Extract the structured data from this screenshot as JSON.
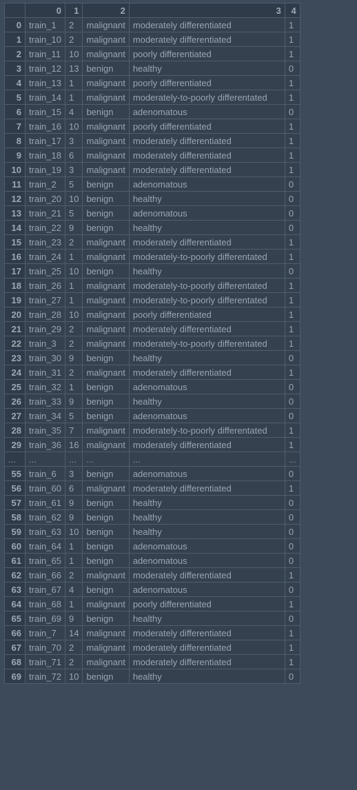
{
  "columns": [
    "0",
    "1",
    "2",
    "3",
    "4"
  ],
  "ellipsis": "...",
  "rows_top": [
    {
      "idx": "0",
      "c0": "train_1",
      "c1": "2",
      "c2": "malignant",
      "c3": "moderately differentiated",
      "c4": "1"
    },
    {
      "idx": "1",
      "c0": "train_10",
      "c1": "2",
      "c2": "malignant",
      "c3": "moderately differentiated",
      "c4": "1"
    },
    {
      "idx": "2",
      "c0": "train_11",
      "c1": "10",
      "c2": "malignant",
      "c3": "poorly differentiated",
      "c4": "1"
    },
    {
      "idx": "3",
      "c0": "train_12",
      "c1": "13",
      "c2": "benign",
      "c3": "healthy",
      "c4": "0"
    },
    {
      "idx": "4",
      "c0": "train_13",
      "c1": "1",
      "c2": "malignant",
      "c3": "poorly differentiated",
      "c4": "1"
    },
    {
      "idx": "5",
      "c0": "train_14",
      "c1": "1",
      "c2": "malignant",
      "c3": "moderately-to-poorly differentated",
      "c4": "1"
    },
    {
      "idx": "6",
      "c0": "train_15",
      "c1": "4",
      "c2": "benign",
      "c3": "adenomatous",
      "c4": "0"
    },
    {
      "idx": "7",
      "c0": "train_16",
      "c1": "10",
      "c2": "malignant",
      "c3": "poorly differentiated",
      "c4": "1"
    },
    {
      "idx": "8",
      "c0": "train_17",
      "c1": "3",
      "c2": "malignant",
      "c3": "moderately differentiated",
      "c4": "1"
    },
    {
      "idx": "9",
      "c0": "train_18",
      "c1": "6",
      "c2": "malignant",
      "c3": "moderately differentiated",
      "c4": "1"
    },
    {
      "idx": "10",
      "c0": "train_19",
      "c1": "3",
      "c2": "malignant",
      "c3": "moderately differentiated",
      "c4": "1"
    },
    {
      "idx": "11",
      "c0": "train_2",
      "c1": "5",
      "c2": "benign",
      "c3": "adenomatous",
      "c4": "0"
    },
    {
      "idx": "12",
      "c0": "train_20",
      "c1": "10",
      "c2": "benign",
      "c3": "healthy",
      "c4": "0"
    },
    {
      "idx": "13",
      "c0": "train_21",
      "c1": "5",
      "c2": "benign",
      "c3": "adenomatous",
      "c4": "0"
    },
    {
      "idx": "14",
      "c0": "train_22",
      "c1": "9",
      "c2": "benign",
      "c3": "healthy",
      "c4": "0"
    },
    {
      "idx": "15",
      "c0": "train_23",
      "c1": "2",
      "c2": "malignant",
      "c3": "moderately differentiated",
      "c4": "1"
    },
    {
      "idx": "16",
      "c0": "train_24",
      "c1": "1",
      "c2": "malignant",
      "c3": "moderately-to-poorly differentated",
      "c4": "1"
    },
    {
      "idx": "17",
      "c0": "train_25",
      "c1": "10",
      "c2": "benign",
      "c3": "healthy",
      "c4": "0"
    },
    {
      "idx": "18",
      "c0": "train_26",
      "c1": "1",
      "c2": "malignant",
      "c3": "moderately-to-poorly differentated",
      "c4": "1"
    },
    {
      "idx": "19",
      "c0": "train_27",
      "c1": "1",
      "c2": "malignant",
      "c3": "moderately-to-poorly differentated",
      "c4": "1"
    },
    {
      "idx": "20",
      "c0": "train_28",
      "c1": "10",
      "c2": "malignant",
      "c3": "poorly differentiated",
      "c4": "1"
    },
    {
      "idx": "21",
      "c0": "train_29",
      "c1": "2",
      "c2": "malignant",
      "c3": "moderately differentiated",
      "c4": "1"
    },
    {
      "idx": "22",
      "c0": "train_3",
      "c1": "2",
      "c2": "malignant",
      "c3": "moderately-to-poorly differentated",
      "c4": "1"
    },
    {
      "idx": "23",
      "c0": "train_30",
      "c1": "9",
      "c2": "benign",
      "c3": "healthy",
      "c4": "0"
    },
    {
      "idx": "24",
      "c0": "train_31",
      "c1": "2",
      "c2": "malignant",
      "c3": "moderately differentiated",
      "c4": "1"
    },
    {
      "idx": "25",
      "c0": "train_32",
      "c1": "1",
      "c2": "benign",
      "c3": "adenomatous",
      "c4": "0"
    },
    {
      "idx": "26",
      "c0": "train_33",
      "c1": "9",
      "c2": "benign",
      "c3": "healthy",
      "c4": "0"
    },
    {
      "idx": "27",
      "c0": "train_34",
      "c1": "5",
      "c2": "benign",
      "c3": "adenomatous",
      "c4": "0"
    },
    {
      "idx": "28",
      "c0": "train_35",
      "c1": "7",
      "c2": "malignant",
      "c3": "moderately-to-poorly differentated",
      "c4": "1"
    },
    {
      "idx": "29",
      "c0": "train_36",
      "c1": "16",
      "c2": "malignant",
      "c3": "moderately differentiated",
      "c4": "1"
    }
  ],
  "rows_bottom": [
    {
      "idx": "55",
      "c0": "train_6",
      "c1": "3",
      "c2": "benign",
      "c3": "adenomatous",
      "c4": "0"
    },
    {
      "idx": "56",
      "c0": "train_60",
      "c1": "6",
      "c2": "malignant",
      "c3": "moderately differentiated",
      "c4": "1"
    },
    {
      "idx": "57",
      "c0": "train_61",
      "c1": "9",
      "c2": "benign",
      "c3": "healthy",
      "c4": "0"
    },
    {
      "idx": "58",
      "c0": "train_62",
      "c1": "9",
      "c2": "benign",
      "c3": "healthy",
      "c4": "0"
    },
    {
      "idx": "59",
      "c0": "train_63",
      "c1": "10",
      "c2": "benign",
      "c3": "healthy",
      "c4": "0"
    },
    {
      "idx": "60",
      "c0": "train_64",
      "c1": "1",
      "c2": "benign",
      "c3": "adenomatous",
      "c4": "0"
    },
    {
      "idx": "61",
      "c0": "train_65",
      "c1": "1",
      "c2": "benign",
      "c3": "adenomatous",
      "c4": "0"
    },
    {
      "idx": "62",
      "c0": "train_66",
      "c1": "2",
      "c2": "malignant",
      "c3": "moderately differentiated",
      "c4": "1"
    },
    {
      "idx": "63",
      "c0": "train_67",
      "c1": "4",
      "c2": "benign",
      "c3": "adenomatous",
      "c4": "0"
    },
    {
      "idx": "64",
      "c0": "train_68",
      "c1": "1",
      "c2": "malignant",
      "c3": "poorly differentiated",
      "c4": "1"
    },
    {
      "idx": "65",
      "c0": "train_69",
      "c1": "9",
      "c2": "benign",
      "c3": "healthy",
      "c4": "0"
    },
    {
      "idx": "66",
      "c0": "train_7",
      "c1": "14",
      "c2": "malignant",
      "c3": "moderately differentiated",
      "c4": "1"
    },
    {
      "idx": "67",
      "c0": "train_70",
      "c1": "2",
      "c2": "malignant",
      "c3": "moderately differentiated",
      "c4": "1"
    },
    {
      "idx": "68",
      "c0": "train_71",
      "c1": "2",
      "c2": "malignant",
      "c3": "moderately differentiated",
      "c4": "1"
    },
    {
      "idx": "69",
      "c0": "train_72",
      "c1": "10",
      "c2": "benign",
      "c3": "healthy",
      "c4": "0"
    }
  ]
}
